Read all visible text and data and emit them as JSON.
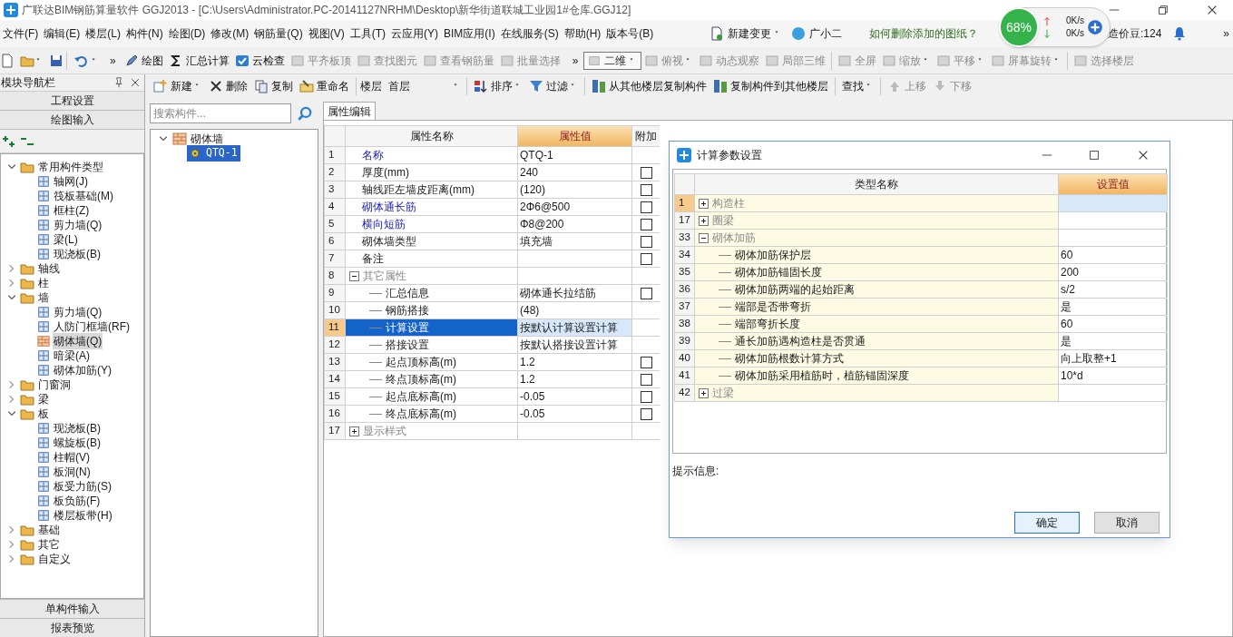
{
  "window": {
    "title": "广联达BIM钢筋算量软件 GGJ2013 - [C:\\Users\\Administrator.PC-20141127NRHM\\Desktop\\新华街道联城工业园1#仓库.GGJ12]"
  },
  "menu": [
    "文件(F)",
    "编辑(E)",
    "楼层(L)",
    "构件(N)",
    "绘图(D)",
    "修改(M)",
    "钢筋量(Q)",
    "视图(V)",
    "工具(T)",
    "云应用(Y)",
    "BIM应用(I)",
    "在线服务(S)",
    "帮助(H)",
    "版本号(B)"
  ],
  "menu_extras": {
    "change": "新建变更",
    "assistant": "广小二",
    "tip": "如何删除添加的图纸？",
    "credits": "造价豆:124",
    "overflow_mark": "»"
  },
  "net_widget": {
    "percent": "68%",
    "up": "0K/s",
    "down": "0K/s"
  },
  "toolbar": {
    "overflow_marks": [
      "»",
      "»"
    ],
    "tools": [
      {
        "label": "绘图",
        "disabled": false
      },
      {
        "label": "汇总计算",
        "disabled": false
      },
      {
        "label": "云检查",
        "disabled": false
      },
      {
        "label": "平齐板顶",
        "disabled": true
      },
      {
        "label": "查找图元",
        "disabled": true
      },
      {
        "label": "查看钢筋量",
        "disabled": true
      },
      {
        "label": "批量选择",
        "disabled": true
      }
    ],
    "view_select": "二维",
    "view_tools": [
      {
        "label": "俯视",
        "disabled": true,
        "dropdown": true
      },
      {
        "label": "动态观察",
        "disabled": true,
        "dropdown": false
      },
      {
        "label": "局部三维",
        "disabled": true,
        "dropdown": false
      },
      {
        "label": "全屏",
        "disabled": true,
        "dropdown": false
      },
      {
        "label": "缩放",
        "disabled": true,
        "dropdown": true
      },
      {
        "label": "平移",
        "disabled": true,
        "dropdown": true
      },
      {
        "label": "屏幕旋转",
        "disabled": true,
        "dropdown": true
      },
      {
        "label": "选择楼层",
        "disabled": true,
        "dropdown": false
      }
    ]
  },
  "nav": {
    "title": "模块导航栏",
    "top_buttons": [
      "工程设置",
      "绘图输入"
    ],
    "bottom_buttons": [
      "单构件输入",
      "报表预览"
    ],
    "tree": [
      {
        "label": "常用构件类型",
        "expanded": true,
        "selected": false,
        "children": [
          {
            "label": "轴网(J)",
            "selected": false
          },
          {
            "label": "筏板基础(M)",
            "selected": false
          },
          {
            "label": "框柱(Z)",
            "selected": false
          },
          {
            "label": "剪力墙(Q)",
            "selected": false
          },
          {
            "label": "梁(L)",
            "selected": false
          },
          {
            "label": "现浇板(B)",
            "selected": false
          }
        ]
      },
      {
        "label": "轴线",
        "expanded": false,
        "selected": false
      },
      {
        "label": "柱",
        "expanded": false,
        "selected": false
      },
      {
        "label": "墙",
        "expanded": true,
        "selected": false,
        "children": [
          {
            "label": "剪力墙(Q)",
            "selected": false
          },
          {
            "label": "人防门框墙(RF)",
            "selected": false
          },
          {
            "label": "砌体墙(Q)",
            "selected": true
          },
          {
            "label": "暗梁(A)",
            "selected": false
          },
          {
            "label": "砌体加筋(Y)",
            "selected": false
          }
        ]
      },
      {
        "label": "门窗洞",
        "expanded": false,
        "selected": false
      },
      {
        "label": "梁",
        "expanded": false,
        "selected": false
      },
      {
        "label": "板",
        "expanded": true,
        "selected": false,
        "children": [
          {
            "label": "现浇板(B)",
            "selected": false
          },
          {
            "label": "螺旋板(B)",
            "selected": false
          },
          {
            "label": "柱帽(V)",
            "selected": false
          },
          {
            "label": "板洞(N)",
            "selected": false
          },
          {
            "label": "板受力筋(S)",
            "selected": false
          },
          {
            "label": "板负筋(F)",
            "selected": false
          },
          {
            "label": "楼层板带(H)",
            "selected": false
          }
        ]
      },
      {
        "label": "基础",
        "expanded": false,
        "selected": false
      },
      {
        "label": "其它",
        "expanded": false,
        "selected": false
      },
      {
        "label": "自定义",
        "expanded": false,
        "selected": false
      }
    ]
  },
  "component_toolbar": {
    "tools_left": [
      {
        "label": "新建",
        "dropdown": true
      },
      {
        "label": "删除",
        "dropdown": false
      },
      {
        "label": "复制",
        "dropdown": false
      },
      {
        "label": "重命名",
        "dropdown": false
      }
    ],
    "floor": {
      "label": "楼层",
      "value": "首层"
    },
    "tools_right": [
      {
        "label": "排序",
        "dropdown": true,
        "disabled": false
      },
      {
        "label": "过滤",
        "dropdown": true,
        "disabled": false
      },
      {
        "label": "从其他楼层复制构件",
        "dropdown": false,
        "disabled": false
      },
      {
        "label": "复制构件到其他楼层",
        "dropdown": false,
        "disabled": false
      },
      {
        "label": "查找",
        "dropdown": true,
        "disabled": false
      },
      {
        "label": "上移",
        "dropdown": false,
        "disabled": true
      },
      {
        "label": "下移",
        "dropdown": false,
        "disabled": true
      }
    ]
  },
  "component_search": {
    "placeholder": "搜索构件..."
  },
  "component_tree": [
    {
      "label": "砌体墙",
      "expanded": true,
      "selected": false,
      "children": [
        {
          "label": "QTQ-1",
          "selected": true
        }
      ]
    }
  ],
  "properties": {
    "tab": "属性编辑",
    "columns": [
      "属性名称",
      "属性值",
      "附加"
    ],
    "rows": [
      {
        "num": "1",
        "name": "名称",
        "value": "QTQ-1",
        "kind": "link",
        "selected": false
      },
      {
        "num": "2",
        "name": "厚度(mm)",
        "value": "240",
        "kind": "plain",
        "selected": false,
        "checked": false
      },
      {
        "num": "3",
        "name": "轴线距左墙皮距离(mm)",
        "value": "(120)",
        "kind": "plain",
        "selected": false,
        "checked": false
      },
      {
        "num": "4",
        "name": "砌体通长筋",
        "value": "2Φ6@500",
        "kind": "link",
        "selected": false,
        "checked": false
      },
      {
        "num": "5",
        "name": "横向短筋",
        "value": "Φ8@200",
        "kind": "link",
        "selected": false,
        "checked": false
      },
      {
        "num": "6",
        "name": "砌体墙类型",
        "value": "填充墙",
        "kind": "plain",
        "selected": false,
        "checked": false
      },
      {
        "num": "7",
        "name": "备注",
        "kind": "plain",
        "selected": false,
        "checked": false
      },
      {
        "num": "8",
        "name": "其它属性",
        "kind": "group",
        "expanded": true,
        "selected": false,
        "children": [
          {
            "num": "9",
            "name": "汇总信息",
            "value": "砌体通长拉结筋",
            "kind": "plain",
            "selected": false,
            "checked": false
          },
          {
            "num": "10",
            "name": "钢筋搭接",
            "value": "(48)",
            "kind": "plain",
            "selected": false
          },
          {
            "num": "11",
            "name": "计算设置",
            "value": "按默认计算设置计算",
            "kind": "plain",
            "selected": true
          },
          {
            "num": "12",
            "name": "搭接设置",
            "value": "按默认搭接设置计算",
            "kind": "plain",
            "selected": false
          },
          {
            "num": "13",
            "name": "起点顶标高(m)",
            "value": "1.2",
            "kind": "plain",
            "selected": false,
            "checked": false
          },
          {
            "num": "14",
            "name": "终点顶标高(m)",
            "value": "1.2",
            "kind": "plain",
            "selected": false,
            "checked": false
          },
          {
            "num": "15",
            "name": "起点底标高(m)",
            "value": "-0.05",
            "kind": "plain",
            "selected": false,
            "checked": false
          },
          {
            "num": "16",
            "name": "终点底标高(m)",
            "value": "-0.05",
            "kind": "plain",
            "selected": false,
            "checked": false
          }
        ]
      },
      {
        "num": "17",
        "name": "显示样式",
        "kind": "group",
        "expanded": false,
        "selected": false
      }
    ]
  },
  "dialog": {
    "title": "计算参数设置",
    "columns": [
      "类型名称",
      "设置值"
    ],
    "rows": [
      {
        "num": "1",
        "name": "构造柱",
        "kind": "group",
        "expanded": false,
        "selected": true
      },
      {
        "num": "17",
        "name": "圈梁",
        "kind": "group",
        "expanded": false,
        "selected": false
      },
      {
        "num": "33",
        "name": "砌体加筋",
        "kind": "group",
        "expanded": true,
        "selected": false,
        "children": [
          {
            "num": "34",
            "name": "砌体加筋保护层",
            "value": "60",
            "kind": "plain",
            "selected": false
          },
          {
            "num": "35",
            "name": "砌体加筋锚固长度",
            "value": "200",
            "kind": "plain",
            "selected": false
          },
          {
            "num": "36",
            "name": "砌体加筋两端的起始距离",
            "value": "s/2",
            "kind": "plain",
            "selected": false
          },
          {
            "num": "37",
            "name": "端部是否带弯折",
            "value": "是",
            "kind": "plain",
            "selected": false
          },
          {
            "num": "38",
            "name": "端部弯折长度",
            "value": "60",
            "kind": "plain",
            "selected": false
          },
          {
            "num": "39",
            "name": "通长加筋遇构造柱是否贯通",
            "value": "是",
            "kind": "plain",
            "selected": false
          },
          {
            "num": "40",
            "name": "砌体加筋根数计算方式",
            "value": "向上取整+1",
            "kind": "plain",
            "selected": false
          },
          {
            "num": "41",
            "name": "砌体加筋采用植筋时，植筋锚固深度",
            "value": "10*d",
            "kind": "plain",
            "selected": false
          }
        ]
      },
      {
        "num": "42",
        "name": "过梁",
        "kind": "group",
        "expanded": false,
        "selected": false
      }
    ],
    "hint_label": "提示信息:",
    "buttons": [
      "确定",
      "取消"
    ]
  }
}
